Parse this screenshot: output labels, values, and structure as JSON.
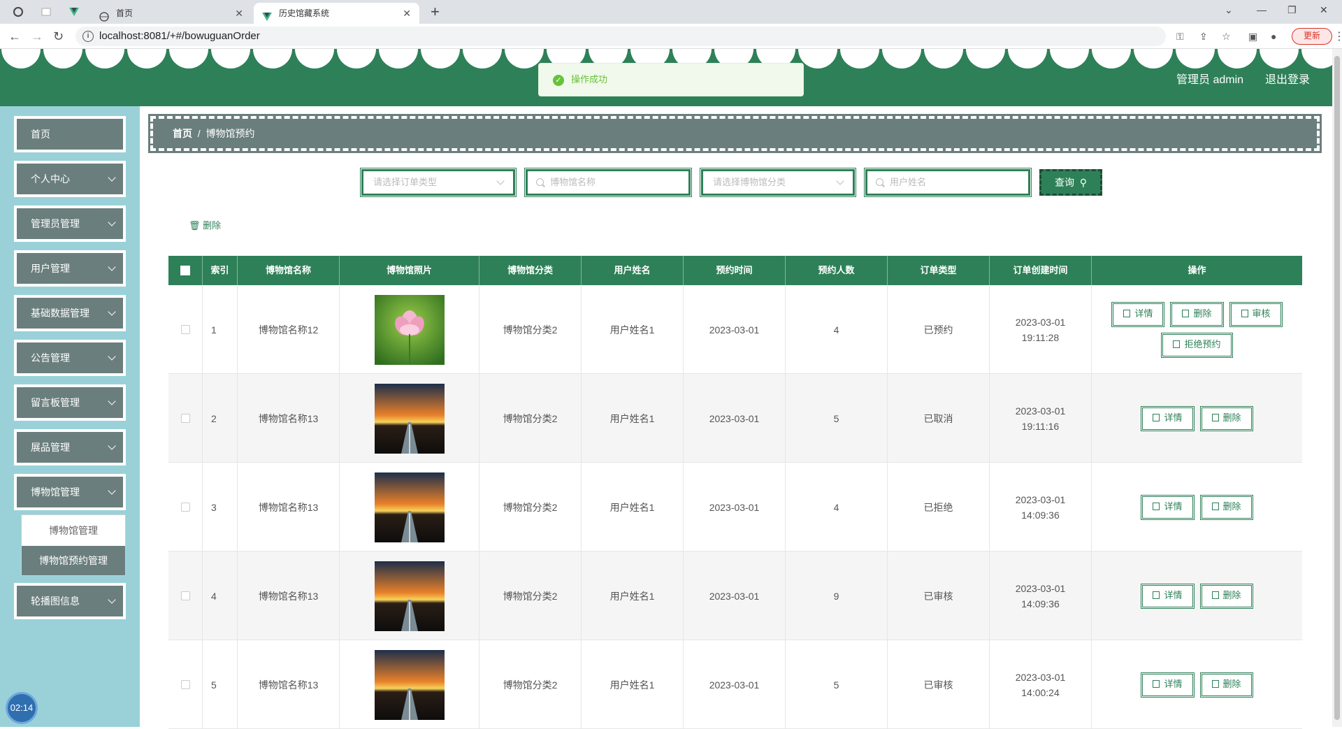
{
  "browser": {
    "tabs": [
      {
        "label": "首页",
        "active": false
      },
      {
        "label": "历史馆藏系统",
        "active": true
      }
    ],
    "url": "localhost:8081/+#/bowuguanOrder",
    "update_label": "更新"
  },
  "header": {
    "user_label": "管理员 admin",
    "logout_label": "退出登录",
    "brand_color": "#2e8058"
  },
  "toast": {
    "message": "操作成功"
  },
  "sidebar": {
    "items": [
      {
        "label": "首页",
        "expandable": false
      },
      {
        "label": "个人中心",
        "expandable": true
      },
      {
        "label": "管理员管理",
        "expandable": true
      },
      {
        "label": "用户管理",
        "expandable": true
      },
      {
        "label": "基础数据管理",
        "expandable": true
      },
      {
        "label": "公告管理",
        "expandable": true
      },
      {
        "label": "留言板管理",
        "expandable": true
      },
      {
        "label": "展品管理",
        "expandable": true
      },
      {
        "label": "博物馆管理",
        "expandable": true
      },
      {
        "label": "轮播图信息",
        "expandable": true
      }
    ],
    "submenu": [
      "博物馆管理",
      "博物馆预约管理"
    ],
    "timer": "02:14"
  },
  "breadcrumb": {
    "home": "首页",
    "separator": "/",
    "current": "博物馆预约"
  },
  "search": {
    "order_type_placeholder": "请选择订单类型",
    "museum_name_placeholder": "博物馆名称",
    "museum_category_placeholder": "请选择博物馆分类",
    "user_name_placeholder": "用户姓名",
    "query_label": "查询"
  },
  "actions": {
    "delete_label": "删除"
  },
  "table": {
    "headers": [
      "索引",
      "博物馆名称",
      "博物馆照片",
      "博物馆分类",
      "用户姓名",
      "预约时间",
      "预约人数",
      "订单类型",
      "订单创建时间",
      "操作"
    ],
    "rows": [
      {
        "index": "1",
        "name": "博物馆名称12",
        "image": "lotus",
        "category": "博物馆分类2",
        "user": "用户姓名1",
        "date": "2023-03-01",
        "count": "4",
        "status": "已预约",
        "created": "2023-03-01 19:11:28",
        "ops": [
          "详情",
          "删除",
          "审核",
          "拒绝预约"
        ]
      },
      {
        "index": "2",
        "name": "博物馆名称13",
        "image": "sunset-road",
        "category": "博物馆分类2",
        "user": "用户姓名1",
        "date": "2023-03-01",
        "count": "5",
        "status": "已取消",
        "created": "2023-03-01 19:11:16",
        "ops": [
          "详情",
          "删除"
        ]
      },
      {
        "index": "3",
        "name": "博物馆名称13",
        "image": "sunset-road",
        "category": "博物馆分类2",
        "user": "用户姓名1",
        "date": "2023-03-01",
        "count": "4",
        "status": "已拒绝",
        "created": "2023-03-01 14:09:36",
        "ops": [
          "详情",
          "删除"
        ]
      },
      {
        "index": "4",
        "name": "博物馆名称13",
        "image": "sunset-road",
        "category": "博物馆分类2",
        "user": "用户姓名1",
        "date": "2023-03-01",
        "count": "9",
        "status": "已审核",
        "created": "2023-03-01 14:09:36",
        "ops": [
          "详情",
          "删除"
        ]
      },
      {
        "index": "5",
        "name": "博物馆名称13",
        "image": "sunset-road",
        "category": "博物馆分类2",
        "user": "用户姓名1",
        "date": "2023-03-01",
        "count": "5",
        "status": "已审核",
        "created": "2023-03-01 14:00:24",
        "ops": [
          "详情",
          "删除"
        ]
      }
    ]
  }
}
